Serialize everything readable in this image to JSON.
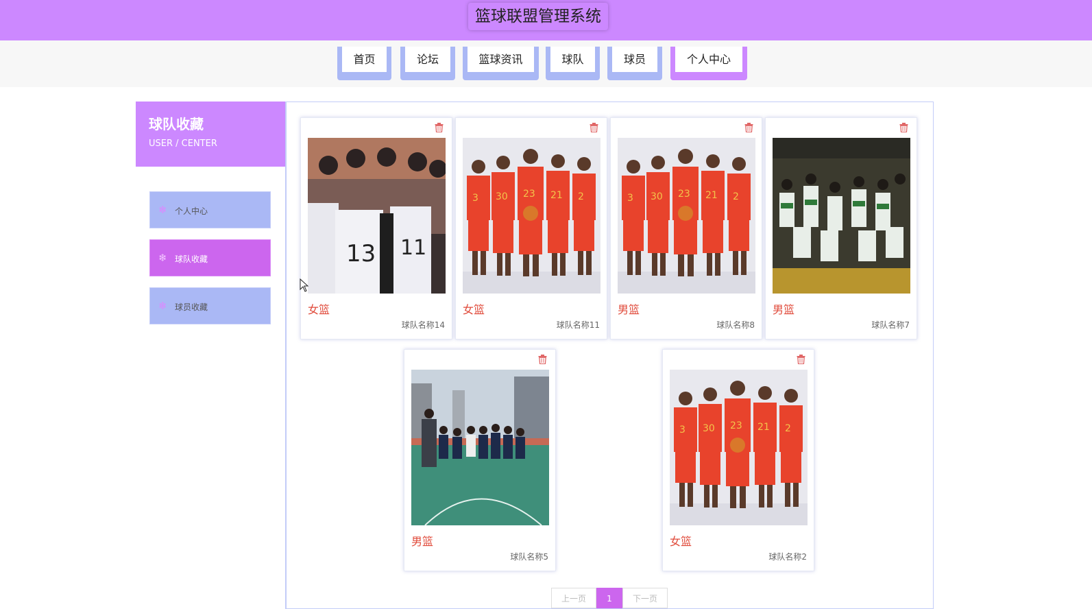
{
  "app": {
    "title": "篮球联盟管理系统",
    "brand_color": "#cc88ff",
    "nav_color": "#aab8f5",
    "accent_color": "#cc66ee"
  },
  "nav": {
    "items": [
      {
        "label": "首页"
      },
      {
        "label": "论坛"
      },
      {
        "label": "篮球资讯"
      },
      {
        "label": "球队"
      },
      {
        "label": "球员"
      },
      {
        "label": "个人中心",
        "active": true
      }
    ]
  },
  "sidebar": {
    "title": "球队收藏",
    "subtitle": "USER / CENTER",
    "items": [
      {
        "label": "个人中心",
        "icon": "snowflake-icon"
      },
      {
        "label": "球队收藏",
        "icon": "snowflake-icon",
        "active": true
      },
      {
        "label": "球员收藏",
        "icon": "snowflake-icon"
      }
    ]
  },
  "cards": [
    {
      "type": "女篮",
      "name": "球队名称14",
      "photo": "team-huddle-photo"
    },
    {
      "type": "女篮",
      "name": "球队名称11",
      "photo": "cleveland-players-photo"
    },
    {
      "type": "男篮",
      "name": "球队名称8",
      "photo": "cleveland-players-photo"
    },
    {
      "type": "男篮",
      "name": "球队名称7",
      "photo": "champions-celebration-photo"
    },
    {
      "type": "男篮",
      "name": "球队名称5",
      "photo": "outdoor-court-team-photo"
    },
    {
      "type": "女篮",
      "name": "球队名称2",
      "photo": "cleveland-players-photo"
    }
  ],
  "pagination": {
    "prev": "上一页",
    "current": "1",
    "next": "下一页"
  }
}
